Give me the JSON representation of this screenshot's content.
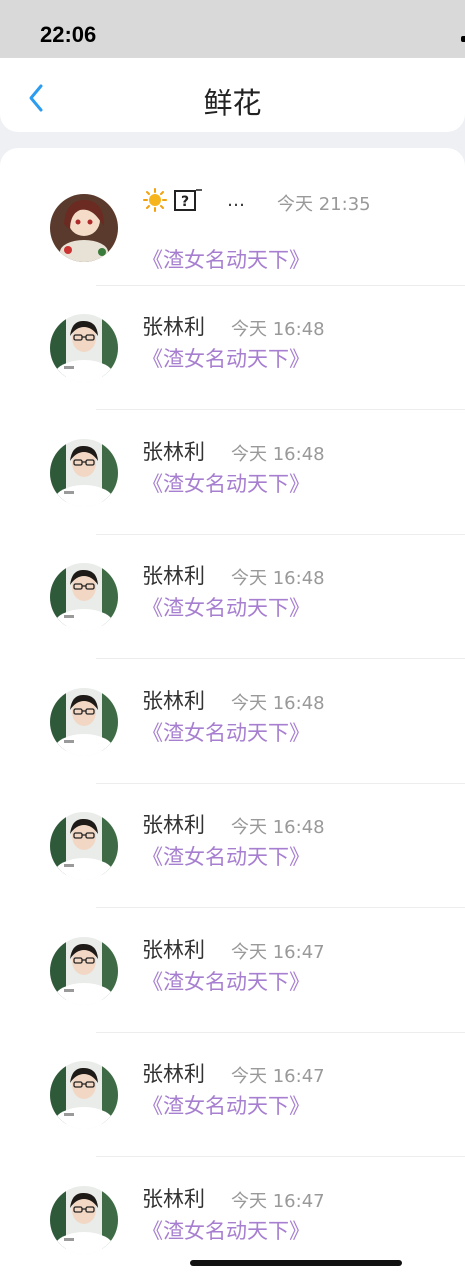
{
  "status_bar": {
    "time": "22:06"
  },
  "nav": {
    "title": "鲜花"
  },
  "list": {
    "first": {
      "name_suffix": "…",
      "time": "今天 21:35",
      "gift": "《渣女名动天下》"
    },
    "rows": [
      {
        "name": "张林利",
        "time": "今天 16:48",
        "gift": "《渣女名动天下》"
      },
      {
        "name": "张林利",
        "time": "今天 16:48",
        "gift": "《渣女名动天下》"
      },
      {
        "name": "张林利",
        "time": "今天 16:48",
        "gift": "《渣女名动天下》"
      },
      {
        "name": "张林利",
        "time": "今天 16:48",
        "gift": "《渣女名动天下》"
      },
      {
        "name": "张林利",
        "time": "今天 16:48",
        "gift": "《渣女名动天下》"
      },
      {
        "name": "张林利",
        "time": "今天 16:47",
        "gift": "《渣女名动天下》"
      },
      {
        "name": "张林利",
        "time": "今天 16:47",
        "gift": "《渣女名动天下》"
      },
      {
        "name": "张林利",
        "time": "今天 16:47",
        "gift": "《渣女名动天下》"
      }
    ]
  },
  "icons": {
    "back": "chevron-left-icon",
    "sun": "sun-emoji-icon",
    "question": "unknown-emoji-icon"
  },
  "colors": {
    "accent": "#2b9cf0",
    "gift_text": "#a77fd0",
    "meta_text": "#999999"
  }
}
